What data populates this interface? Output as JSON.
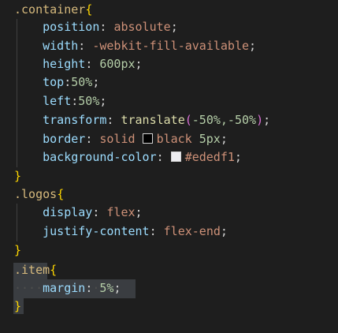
{
  "colors": {
    "swatch_black": "#000000",
    "swatch_ededf1": "#ededf1"
  },
  "lines": [
    {
      "selector": ".container",
      "open": "{"
    },
    {
      "prop": "position",
      "value": "absolute"
    },
    {
      "prop": "width",
      "value": "-webkit-fill-available"
    },
    {
      "prop": "height",
      "value": "600px"
    },
    {
      "prop": "top",
      "value": "50%"
    },
    {
      "prop": "left",
      "value": "50%"
    },
    {
      "prop": "transform",
      "fn": "translate",
      "args": "-50%,-50%"
    },
    {
      "prop": "border",
      "value1": "solid",
      "value2": "black",
      "value3": "5px"
    },
    {
      "prop": "background-color",
      "value": "#ededf1"
    },
    {
      "close": "}"
    },
    {
      "selector": ".logos",
      "open": "{"
    },
    {
      "prop": "display",
      "value": "flex"
    },
    {
      "prop": "justify-content",
      "value": "flex-end"
    },
    {
      "close": "}"
    },
    {
      "selector": ".item",
      "open": "{"
    },
    {
      "prop": "margin",
      "value": "5%"
    },
    {
      "close": "}"
    }
  ]
}
